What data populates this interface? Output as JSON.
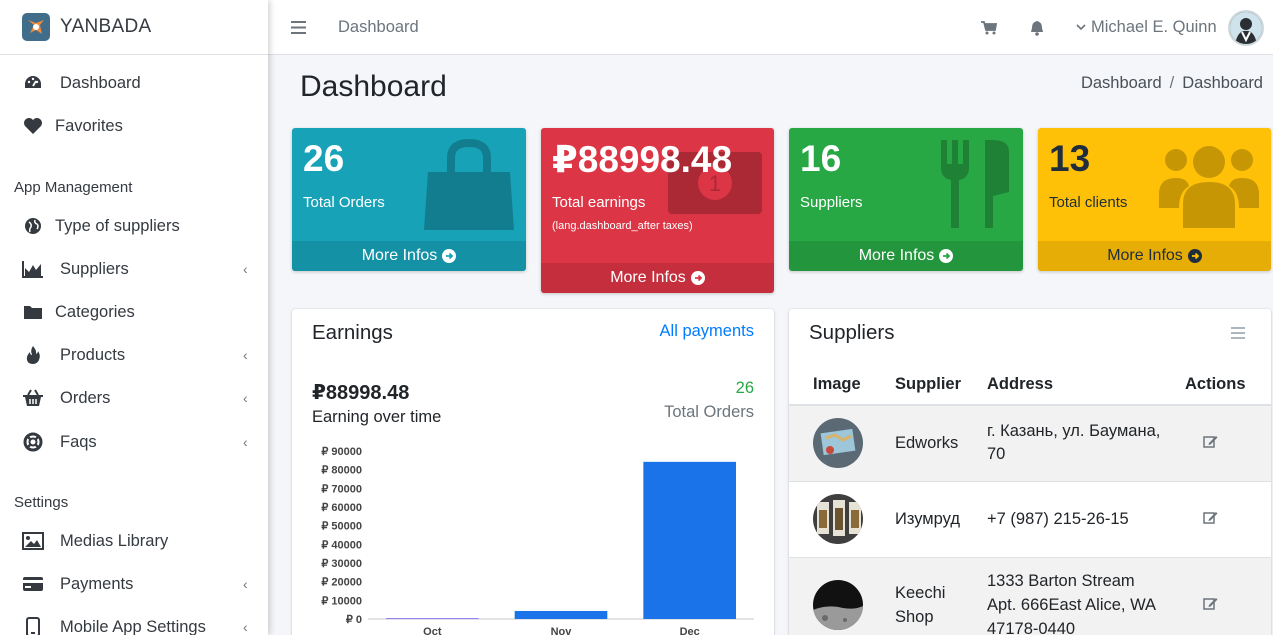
{
  "brand": {
    "name": "YANBADA"
  },
  "sidebar": {
    "items": [
      {
        "label": "Dashboard",
        "icon": "tachometer-icon"
      },
      {
        "label": "Favorites",
        "icon": "heart-icon"
      }
    ],
    "section_app": "App Management",
    "app_items": [
      {
        "label": "Type of suppliers",
        "icon": "globe-icon"
      },
      {
        "label": "Suppliers",
        "icon": "chart-area-icon"
      },
      {
        "label": "Categories",
        "icon": "folder-icon"
      },
      {
        "label": "Products",
        "icon": "fire-icon"
      },
      {
        "label": "Orders",
        "icon": "basket-icon"
      },
      {
        "label": "Faqs",
        "icon": "life-ring-icon"
      }
    ],
    "section_settings": "Settings",
    "settings_items": [
      {
        "label": "Medias Library",
        "icon": "image-icon"
      },
      {
        "label": "Payments",
        "icon": "credit-card-icon"
      },
      {
        "label": "Mobile App Settings",
        "icon": "mobile-icon"
      }
    ]
  },
  "topbar": {
    "breadcrumb": "Dashboard",
    "user_name": "Michael E. Quinn"
  },
  "header": {
    "title": "Dashboard",
    "breadcrumb": [
      "Dashboard",
      "Dashboard"
    ]
  },
  "boxes": [
    {
      "value": "26",
      "label": "Total Orders",
      "footer": "More Infos",
      "color": "#17a2b8",
      "icon": "shopping-bag-icon"
    },
    {
      "value": "₽88998.48",
      "label": "Total earnings",
      "sub": "(lang.dashboard_after taxes)",
      "footer": "More Infos",
      "color": "#dc3545",
      "icon": "money-bill-icon"
    },
    {
      "value": "16",
      "label": "Suppliers",
      "footer": "More Infos",
      "color": "#28a745",
      "icon": "utensils-icon"
    },
    {
      "value": "13",
      "label": "Total clients",
      "footer": "More Infos",
      "color": "#ffc107",
      "icon": "users-icon"
    }
  ],
  "earnings": {
    "title": "Earnings",
    "all_payments": "All payments",
    "amount": "₽88998.48",
    "amount_label": "Earning over time",
    "orders": "26",
    "orders_label": "Total Orders"
  },
  "chart_data": {
    "type": "bar",
    "categories": [
      "Oct",
      "Nov",
      "Dec"
    ],
    "values": [
      500,
      4300,
      84200
    ],
    "ylim": [
      0,
      90000
    ],
    "yticks": [
      "₽ 0",
      "₽ 10000",
      "₽ 20000",
      "₽ 30000",
      "₽ 40000",
      "₽ 50000",
      "₽ 60000",
      "₽ 70000",
      "₽ 80000",
      "₽ 90000"
    ],
    "colors": [
      "#8e7cf0",
      "#1a73e8",
      "#1a73e8"
    ],
    "title": "",
    "xlabel": "",
    "ylabel": ""
  },
  "suppliers": {
    "title": "Suppliers",
    "columns": [
      "Image",
      "Supplier",
      "Address",
      "Actions"
    ],
    "rows": [
      {
        "name": "Edworks",
        "address": "г. Казань, ул. Баумана, 70"
      },
      {
        "name": "Изумруд",
        "address": "+7 (987) 215-26-15"
      },
      {
        "name": "Keechi Shop",
        "address": "1333 Barton Stream Apt. 666East Alice, WA 47178-0440"
      }
    ]
  },
  "colors": {
    "link": "#007bff",
    "success": "#28a745"
  }
}
